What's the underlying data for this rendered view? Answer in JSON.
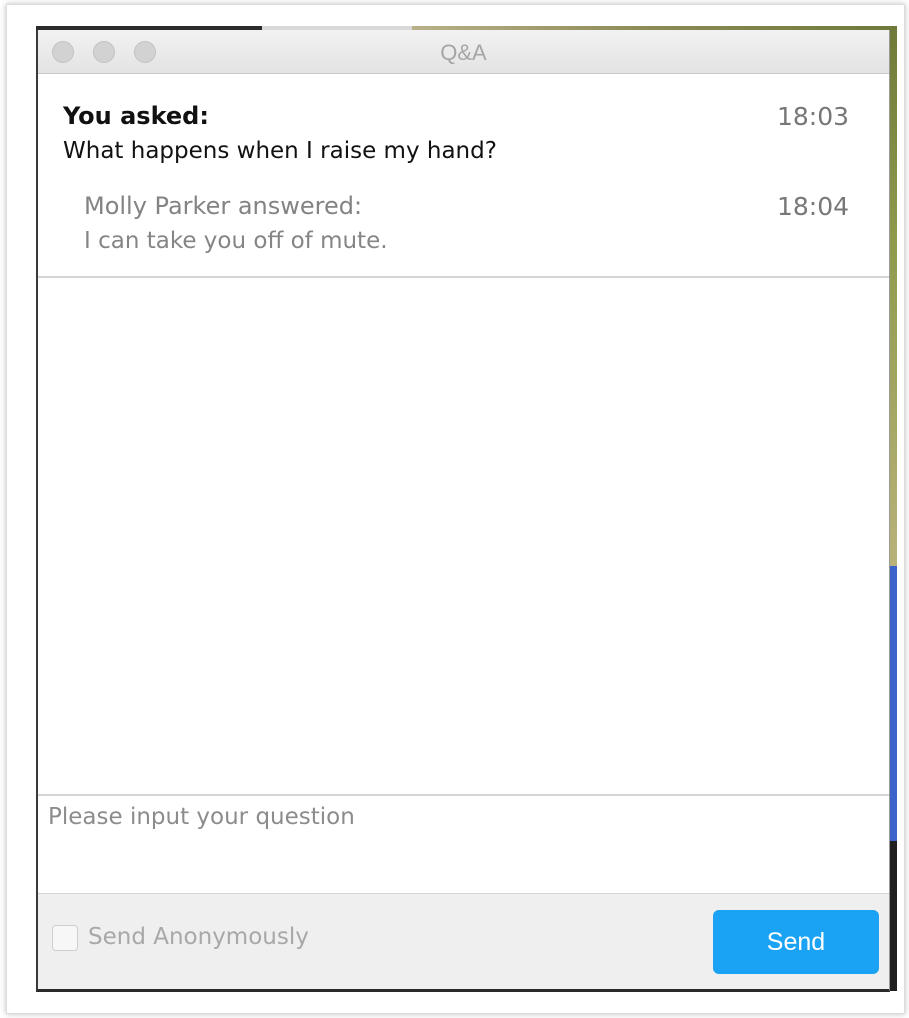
{
  "window": {
    "title": "Q&A"
  },
  "messages": [
    {
      "question_header": "You asked:",
      "question_time": "18:03",
      "question_text": "What happens when I raise my hand?",
      "answer_header": "Molly Parker answered:",
      "answer_time": "18:04",
      "answer_text": "I can take you off of mute."
    }
  ],
  "input": {
    "placeholder": "Please input your question",
    "value": ""
  },
  "footer": {
    "anonymous_label": "Send Anonymously",
    "anonymous_checked": false,
    "send_label": "Send"
  },
  "colors": {
    "send_button": "#1aa3f5",
    "title_text": "#a6a6a6",
    "answer_text": "#858585"
  }
}
